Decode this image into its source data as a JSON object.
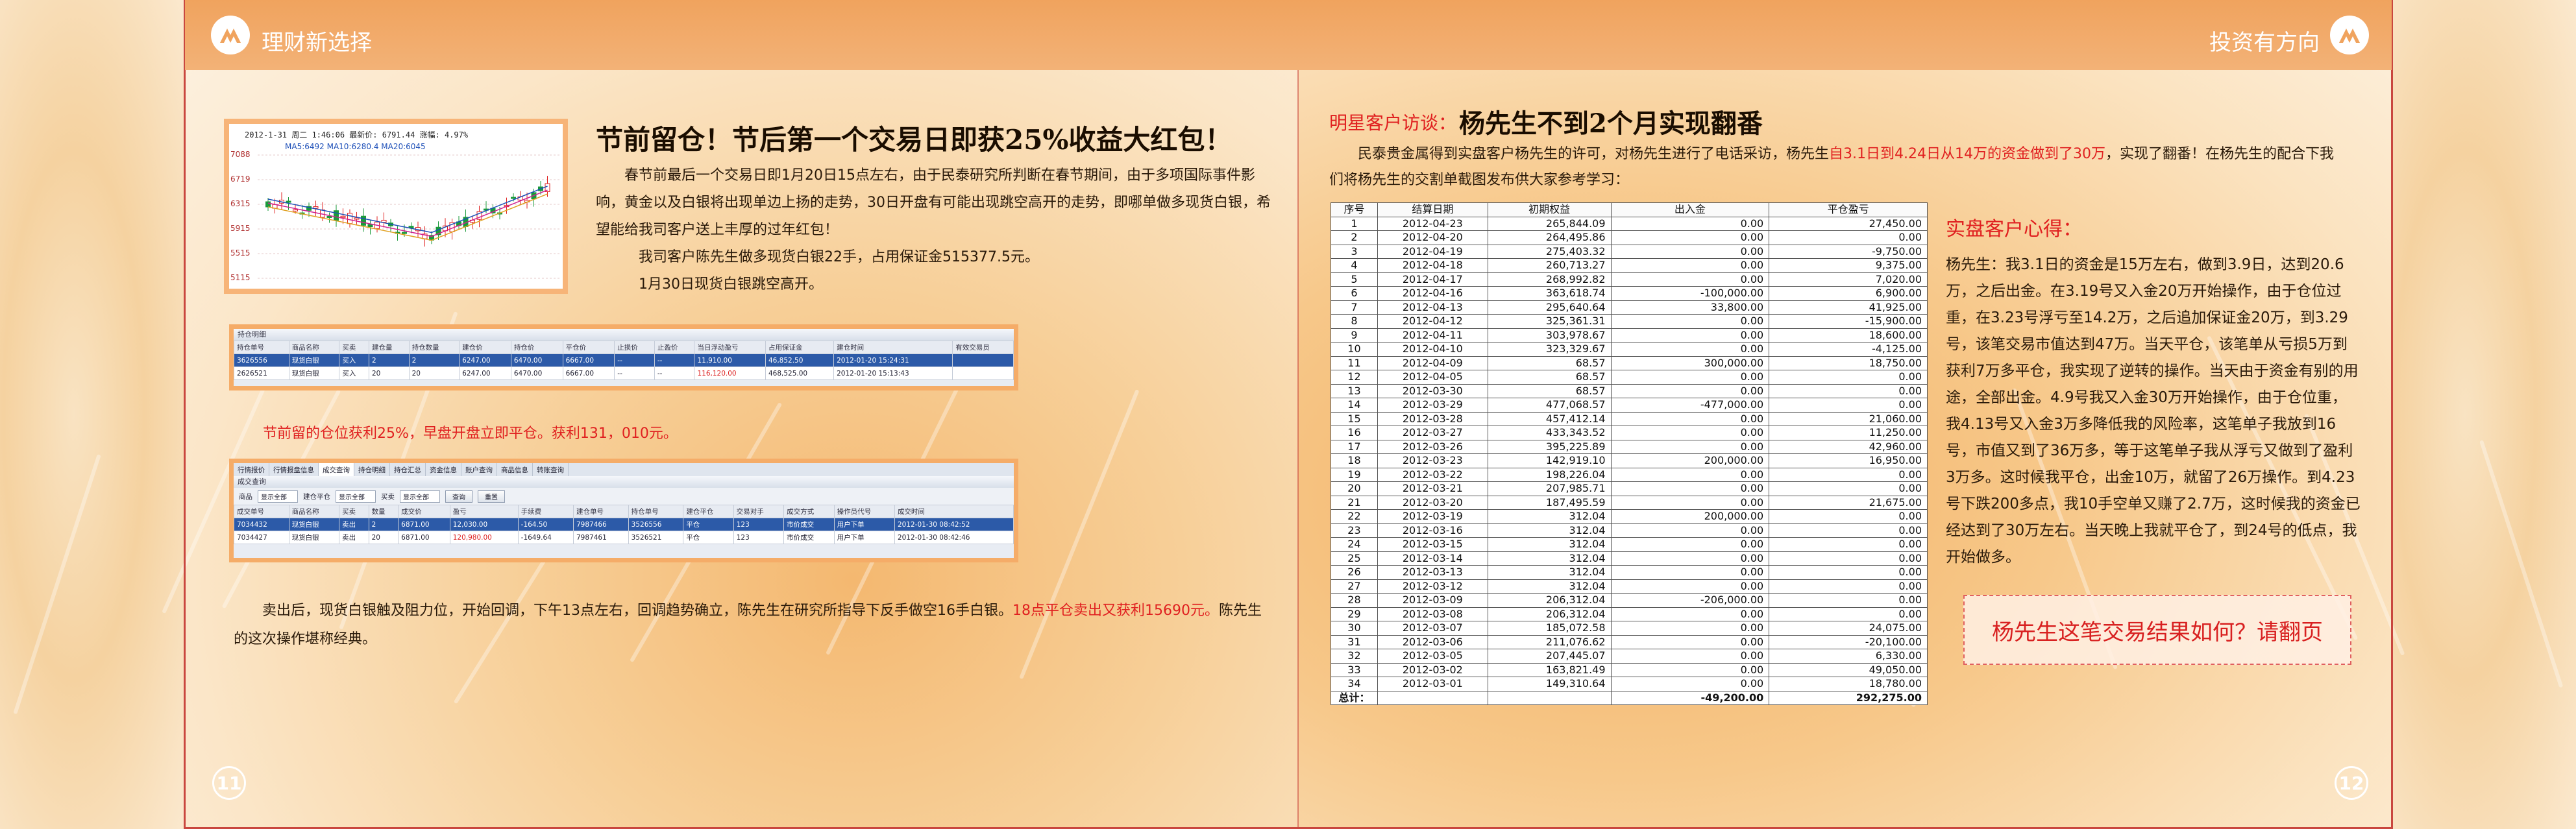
{
  "header": {
    "left_title": "理财新选择",
    "right_title": "投资有方向"
  },
  "page_numbers": {
    "left": "11",
    "right": "12"
  },
  "left_page": {
    "chart_header": "2012-1-31 周二 1:46:06 最新价: 6791.44 涨幅: 4.97%",
    "chart_ma": "MA5:6492 MA10:6280.4 MA20:6045",
    "chart_y_ticks": [
      "7088",
      "6719",
      "6315",
      "5915",
      "5515",
      "5115"
    ],
    "title": "节前留仓！节后第一个交易日即获25%收益大红包！",
    "paragraphs": [
      "春节前最后一个交易日即1月20日15点左右，由于民泰研究所判断在春节期间，由于多项国际事件影响，黄金以及白银将出现单边上扬的走势，30日开盘有可能出现跳空高开的走势，即哪单做多现货白银，希望能给我司客户送上丰厚的过年红包！",
      "我司客户陈先生做多现货白银22手，占用保证金515377.5元。",
      "1月30日现货白银跳空高开。"
    ],
    "position_panel": {
      "title": "持仓明细",
      "columns": [
        "持仓单号",
        "商品名称",
        "买卖",
        "建仓量",
        "持仓数量",
        "建仓价",
        "持仓价",
        "平仓价",
        "止损价",
        "止盈价",
        "当日浮动盈亏",
        "占用保证金",
        "建仓时间",
        "有效交易员"
      ],
      "rows": [
        [
          "3626556",
          "现货白银",
          "买入",
          "2",
          "2",
          "6247.00",
          "6470.00",
          "6667.00",
          "--",
          "--",
          "11,910.00",
          "46,852.50",
          "2012-01-20 15:24:31",
          ""
        ],
        [
          "2626521",
          "现货白银",
          "买入",
          "20",
          "20",
          "6247.00",
          "6470.00",
          "6667.00",
          "--",
          "--",
          "116,120.00",
          "468,525.00",
          "2012-01-20 15:13:43",
          ""
        ]
      ]
    },
    "red_note": "节前留的仓位获利25%，早盘开盘立即平仓。获利131，010元。",
    "deal_panel": {
      "tabs": [
        "行情报价",
        "行情报盘信息",
        "成交查询",
        "持仓明细",
        "持仓汇总",
        "资金信息",
        "账户查询",
        "商品信息",
        "转账查询"
      ],
      "section_title": "成交查询",
      "filters": {
        "product_label": "商品",
        "product_value": "显示全部",
        "open_close_label": "建仓平仓",
        "open_close_value": "显示全部",
        "buy_sell_label": "买卖",
        "buy_sell_value": "显示全部",
        "query_button": "查询",
        "reset_button": "重置"
      },
      "columns": [
        "成交单号",
        "商品名称",
        "买卖",
        "数量",
        "成交价",
        "盈亏",
        "手续费",
        "建仓单号",
        "持仓单号",
        "建仓平仓",
        "交易对手",
        "成交方式",
        "操作员代号",
        "成交时间"
      ],
      "rows": [
        [
          "7034432",
          "现货白银",
          "卖出",
          "2",
          "6871.00",
          "12,030.00",
          "-164.50",
          "7987466",
          "3526556",
          "平仓",
          "123",
          "市价成交",
          "用户下单",
          "2012-01-30 08:42:52"
        ],
        [
          "7034427",
          "现货白银",
          "卖出",
          "20",
          "6871.00",
          "120,980.00",
          "-1649.64",
          "7987461",
          "3526521",
          "平仓",
          "123",
          "市价成交",
          "用户下单",
          "2012-01-30 08:42:46"
        ]
      ]
    },
    "closing_text_a": "卖出后，现货白银触及阻力位，开始回调，下午13点左右，回调趋势确立，陈先生在研究所指导下反手做空16手白银。",
    "closing_text_red": "18点平仓卖出又获利15690元。",
    "closing_text_b": "陈先生的这次操作堪称经典。"
  },
  "right_page": {
    "interview_tag": "明星客户访谈：",
    "interview_title": "杨先生不到2个月实现翻番",
    "intro_a": "民泰贵金属得到实盘客户杨先生的许可，对杨先生进行了电话采访，杨先生",
    "intro_red": "自3.1日到4.24日从14万的资金做到了30万",
    "intro_b": "，实现了翻番！在杨先生的配合下我们将杨先生的交割单截图发布供大家参考学习：",
    "table": {
      "columns": [
        "序号",
        "结算日期",
        "初期权益",
        "出入金",
        "平仓盈亏"
      ],
      "rows": [
        [
          "1",
          "2012-04-23",
          "265,844.09",
          "0.00",
          "27,450.00"
        ],
        [
          "2",
          "2012-04-20",
          "264,495.86",
          "0.00",
          "0.00"
        ],
        [
          "3",
          "2012-04-19",
          "275,403.32",
          "0.00",
          "-9,750.00"
        ],
        [
          "4",
          "2012-04-18",
          "260,713.27",
          "0.00",
          "9,375.00"
        ],
        [
          "5",
          "2012-04-17",
          "268,992.82",
          "0.00",
          "7,020.00"
        ],
        [
          "6",
          "2012-04-16",
          "363,618.74",
          "-100,000.00",
          "6,900.00"
        ],
        [
          "7",
          "2012-04-13",
          "295,640.64",
          "33,800.00",
          "41,925.00"
        ],
        [
          "8",
          "2012-04-12",
          "325,361.31",
          "0.00",
          "-15,900.00"
        ],
        [
          "9",
          "2012-04-11",
          "303,978.67",
          "0.00",
          "18,600.00"
        ],
        [
          "10",
          "2012-04-10",
          "323,329.67",
          "0.00",
          "-4,125.00"
        ],
        [
          "11",
          "2012-04-09",
          "68.57",
          "300,000.00",
          "18,750.00"
        ],
        [
          "12",
          "2012-04-05",
          "68.57",
          "0.00",
          "0.00"
        ],
        [
          "13",
          "2012-03-30",
          "68.57",
          "0.00",
          "0.00"
        ],
        [
          "14",
          "2012-03-29",
          "477,068.57",
          "-477,000.00",
          "0.00"
        ],
        [
          "15",
          "2012-03-28",
          "457,412.14",
          "0.00",
          "21,060.00"
        ],
        [
          "16",
          "2012-03-27",
          "433,343.52",
          "0.00",
          "11,250.00"
        ],
        [
          "17",
          "2012-03-26",
          "395,225.89",
          "0.00",
          "42,960.00"
        ],
        [
          "18",
          "2012-03-23",
          "142,919.10",
          "200,000.00",
          "16,950.00"
        ],
        [
          "19",
          "2012-03-22",
          "198,226.04",
          "0.00",
          "0.00"
        ],
        [
          "20",
          "2012-03-21",
          "207,985.71",
          "0.00",
          "0.00"
        ],
        [
          "21",
          "2012-03-20",
          "187,495.59",
          "0.00",
          "21,675.00"
        ],
        [
          "22",
          "2012-03-19",
          "312.04",
          "200,000.00",
          "0.00"
        ],
        [
          "23",
          "2012-03-16",
          "312.04",
          "0.00",
          "0.00"
        ],
        [
          "24",
          "2012-03-15",
          "312.04",
          "0.00",
          "0.00"
        ],
        [
          "25",
          "2012-03-14",
          "312.04",
          "0.00",
          "0.00"
        ],
        [
          "26",
          "2012-03-13",
          "312.04",
          "0.00",
          "0.00"
        ],
        [
          "27",
          "2012-03-12",
          "312.04",
          "0.00",
          "0.00"
        ],
        [
          "28",
          "2012-03-09",
          "206,312.04",
          "-206,000.00",
          "0.00"
        ],
        [
          "29",
          "2012-03-08",
          "206,312.04",
          "0.00",
          "0.00"
        ],
        [
          "30",
          "2012-03-07",
          "185,072.58",
          "0.00",
          "24,075.00"
        ],
        [
          "31",
          "2012-03-06",
          "211,076.62",
          "0.00",
          "-20,100.00"
        ],
        [
          "32",
          "2012-03-05",
          "207,445.07",
          "0.00",
          "6,330.00"
        ],
        [
          "33",
          "2012-03-02",
          "163,821.49",
          "0.00",
          "49,050.00"
        ],
        [
          "34",
          "2012-03-01",
          "149,310.64",
          "0.00",
          "18,780.00"
        ]
      ],
      "total_label": "总计：",
      "total_in_out": "-49,200.00",
      "total_pnl": "292,275.00"
    },
    "experience_title": "实盘客户心得：",
    "experience_text": "杨先生：我3.1日的资金是15万左右，做到3.9日，达到20.6万，之后出金。在3.19号又入金20万开始操作，由于仓位过重，在3.23号浮亏至14.2万，之后追加保证金20万，到3.29号，该笔交易市值达到47万。当天平仓，该笔单从亏损5万到获利7万多平仓，我实现了逆转的操作。当天由于资金有别的用途，全部出金。4.9号我又入金30万开始操作，由于仓位重，我4.13号又入金3万多降低我的风险率，这笔单子我放到16号，市值又到了36万多，等于这笔单子我从浮亏又做到了盈利3万多。这时候我平仓，出金10万，就留了26万操作。到4.23号下跌200多点，我10手空单又赚了2.7万，这时候我的资金已经达到了30万左右。当天晚上我就平仓了，到24号的低点，我开始做多。",
    "cta": "杨先生这笔交易结果如何？请翻页"
  },
  "colors": {
    "header_orange": "#f0a35e",
    "accent_red": "#e02020",
    "border_red": "#c9473f"
  }
}
